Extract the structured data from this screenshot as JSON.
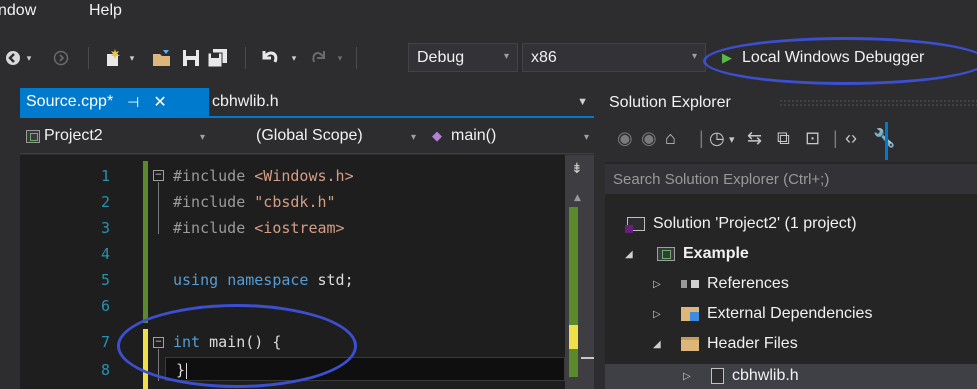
{
  "menu": {
    "window": "ndow",
    "help": "Help"
  },
  "toolbar": {
    "config": "Debug",
    "platform": "x86",
    "debugger": "Local Windows Debugger"
  },
  "tabs": {
    "active": "Source.cpp*",
    "inactive": "cbhwlib.h"
  },
  "navbar": {
    "project": "Project2",
    "scope": "(Global Scope)",
    "member": "main()"
  },
  "editor": {
    "line_numbers": [
      "1",
      "2",
      "3",
      "4",
      "5",
      "6",
      "7",
      "8"
    ],
    "lines": {
      "l1_pre": "#include",
      "l1_arg": "<Windows.h>",
      "l2_pre": "#include",
      "l2_arg": "\"cbsdk.h\"",
      "l3_pre": "#include",
      "l3_arg": "<iostream>",
      "l5_kw1": "using",
      "l5_kw2": "namespace",
      "l5_rest": "std;",
      "l7_kw": "int",
      "l7_rest": "main() {",
      "l8": "}"
    }
  },
  "solution_explorer": {
    "title": "Solution Explorer",
    "search_placeholder": "Search Solution Explorer (Ctrl+;)",
    "solution": "Solution 'Project2' (1 project)",
    "project": "Example",
    "references": "References",
    "external": "External Dependencies",
    "header_files": "Header Files",
    "file": "cbhwlib.h"
  },
  "colors": {
    "accent": "#007acc",
    "annotation_oval": "#3c4fd0"
  }
}
